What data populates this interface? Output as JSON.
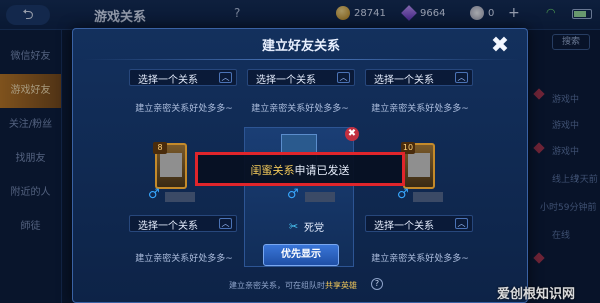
{
  "topbar": {
    "back_label": "⮌",
    "title": "游戏关系",
    "help": "?",
    "gold": "28741",
    "diamonds": "9664",
    "zero": "0",
    "plus": "+"
  },
  "sidebar": {
    "items": [
      "微信好友",
      "游戏好友",
      "关注/粉丝",
      "找朋友",
      "附近的人",
      "師徒"
    ]
  },
  "right_col": {
    "search": "搜索",
    "texts": [
      "游戏中",
      "游戏中",
      "游戏中",
      "线上线",
      "7天前",
      "小时59分钟前",
      "在线"
    ]
  },
  "dialog": {
    "title": "建立好友关系",
    "close": "✖",
    "select_label": "选择一个关系",
    "chevron": "︿",
    "desc": "建立亲密关系好处多多~",
    "relation_name": "死党",
    "relation_icon": "✂",
    "priority_button": "优先显示",
    "footer_text": "建立亲密关系，可在组队时",
    "footer_link": "共享英雄",
    "footer_help": "?",
    "levels": [
      "8",
      "10"
    ]
  },
  "toast": {
    "highlight": "闺蜜关系",
    "message": "申请已发送"
  },
  "watermark": "爱创根知识网"
}
